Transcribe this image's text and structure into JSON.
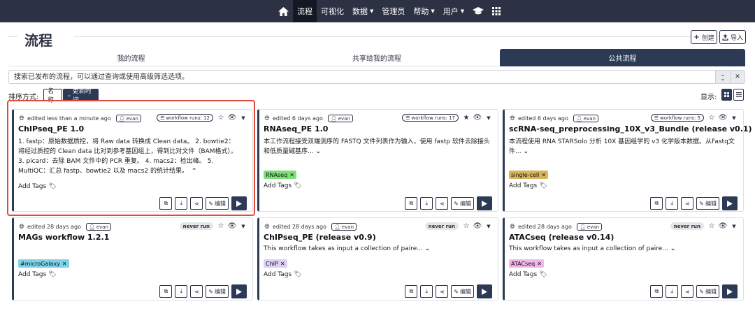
{
  "nav": {
    "items": [
      {
        "label": "流程",
        "active": true
      },
      {
        "label": "可视化"
      },
      {
        "label": "数据",
        "caret": true
      },
      {
        "label": "管理员"
      },
      {
        "label": "帮助",
        "caret": true
      },
      {
        "label": "用户",
        "caret": true
      }
    ]
  },
  "header": {
    "title": "流程",
    "create_label": "创建",
    "import_label": "导入"
  },
  "tabs": {
    "my": "我的流程",
    "shared": "共享给我的流程",
    "public": "公共流程"
  },
  "search": {
    "placeholder": "搜索已发布的流程，可以通过查询或使用高级筛选选项。"
  },
  "sort": {
    "label": "排序方式:",
    "name": "名称",
    "updated": "更新时间"
  },
  "display": {
    "label": "显示:"
  },
  "cards": [
    {
      "edited": "edited less than a minute ago",
      "user": "evan",
      "runs": "workflow runs: 12",
      "never_run": null,
      "title": "ChIPseq_PE 1.0",
      "description": "1. fastp：原始数据质控，将 Raw data 转换成 Clean data。 2. bowtie2：将经过质控的 Clean data 比对到参考基因组上，得到比对文件（BAM格式）。 3. picard：去除 BAM 文件中的 PCR 重复。 4. macs2：检出峰。 5. MultiQC：汇总 fastp、bowtie2 以及 macs2 的统计结果。",
      "tag": null,
      "add_tags": "Add Tags",
      "edit_label": "编辑"
    },
    {
      "edited": "edited 6 days ago",
      "user": "evan",
      "runs": "workflow runs: 17",
      "never_run": null,
      "title": "RNAseq_PE 1.0",
      "description": "本工作流程接受双端测序的 FASTQ 文件列表作为输入，使用 fastp 软件去除接头和低质量碱基序...",
      "tag": "RNAseq",
      "add_tags": "Add Tags",
      "edit_label": "编辑"
    },
    {
      "edited": "edited 6 days ago",
      "user": "evan",
      "runs": "workflow runs: 5",
      "never_run": null,
      "title": "scRNA-seq_preprocessing_10X_v3_Bundle (release v0.1)",
      "description": "本流程使用 RNA STARSolo 分析 10X 基因组学的 v3 化学版本数据。从Fastq文件...",
      "tag": "single-cell",
      "add_tags": "Add Tags",
      "edit_label": "编辑"
    },
    {
      "edited": "edited 28 days ago",
      "user": "evan",
      "runs": null,
      "never_run": "never run",
      "title": "MAGs workflow 1.2.1",
      "description": "",
      "tag": "#microGalaxy",
      "add_tags": "Add Tags",
      "edit_label": "编辑"
    },
    {
      "edited": "edited 28 days ago",
      "user": "evan",
      "runs": null,
      "never_run": "never run",
      "title": "ChIPseq_PE (release v0.9)",
      "description": "This workflow takes as input a collection of paire...",
      "tag": "ChIP",
      "add_tags": "Add Tags",
      "edit_label": "编辑"
    },
    {
      "edited": "edited 28 days ago",
      "user": "evan",
      "runs": null,
      "never_run": "never run",
      "title": "ATACseq (release v0.14)",
      "description": "This workflow takes as input a collection of paire...",
      "tag": "ATACseq",
      "add_tags": "Add Tags",
      "edit_label": "编辑"
    }
  ],
  "colors": {
    "nav_bg": "#2c3143",
    "accent": "#2c3a55",
    "highlight": "#e04a3a",
    "tag_rnaseq": "#7ee07a",
    "tag_singlecell": "#d9b45a",
    "tag_microgalaxy": "#7fd3e8",
    "tag_chip": "#ddd0f5",
    "tag_atacseq": "#f2b6ea"
  }
}
